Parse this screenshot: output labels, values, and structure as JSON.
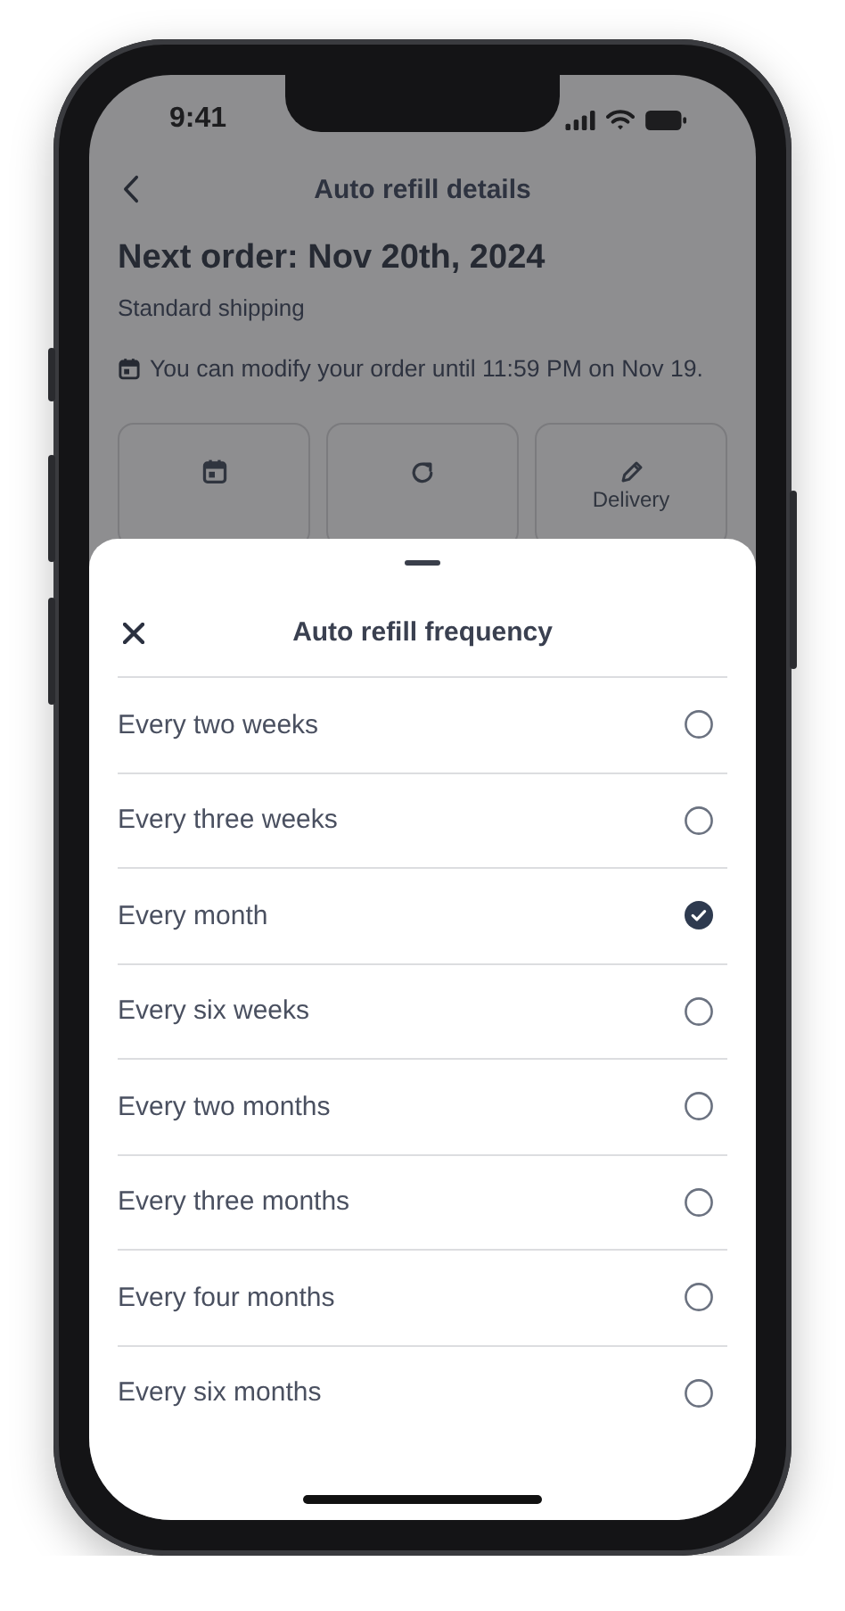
{
  "status_bar": {
    "time": "9:41"
  },
  "header": {
    "title": "Auto refill details"
  },
  "order": {
    "heading": "Next order: Nov 20th, 2024",
    "shipping": "Standard shipping",
    "notice": "You can modify your order until 11:59 PM on Nov 19."
  },
  "delivery_button": {
    "label": "Delivery"
  },
  "sheet": {
    "title": "Auto refill frequency",
    "options": [
      {
        "label": "Every two weeks",
        "selected": false
      },
      {
        "label": "Every three weeks",
        "selected": false
      },
      {
        "label": "Every month",
        "selected": true
      },
      {
        "label": "Every six weeks",
        "selected": false
      },
      {
        "label": "Every two months",
        "selected": false
      },
      {
        "label": "Every three months",
        "selected": false
      },
      {
        "label": "Every four months",
        "selected": false
      },
      {
        "label": "Every six months",
        "selected": false
      }
    ]
  }
}
